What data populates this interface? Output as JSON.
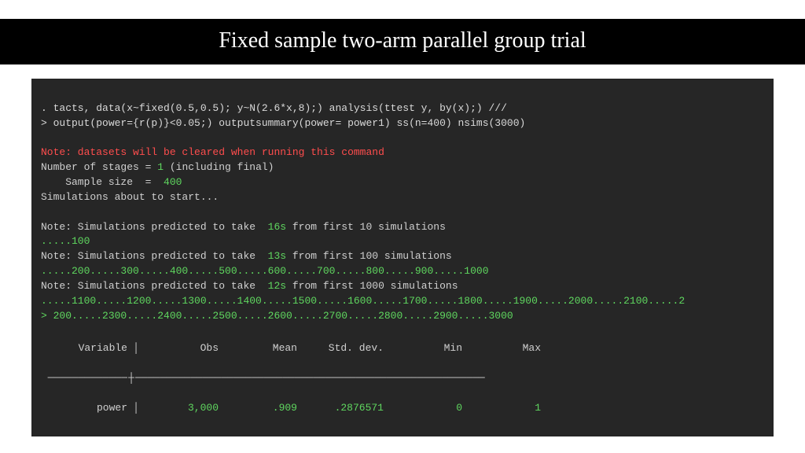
{
  "title": "Fixed sample two-arm parallel group trial",
  "cmd1": ". tacts, data(x~fixed(0.5,0.5); y~N(2.6*x,8);) analysis(ttest y, by(x);) ///",
  "cmd2": "> output(power={r(p)}<0.05;) outputsummary(power= power1) ss(n=400) nsims(3000)",
  "warn": "Note: datasets will be cleared when running this command",
  "line_stages_a": "Number of stages = ",
  "line_stages_n": "1",
  "line_stages_b": " (including final)",
  "line_ss_a": "    Sample size  =  ",
  "line_ss_n": "400",
  "line_start": "Simulations about to start...",
  "pred1_a": "Note: Simulations predicted to take  ",
  "pred1_n": "16s",
  "pred1_b": " from first 10 simulations",
  "dots1": ".....100",
  "pred2_a": "Note: Simulations predicted to take  ",
  "pred2_n": "13s",
  "pred2_b": " from first 100 simulations",
  "dots2": ".....200.....300.....400.....500.....600.....700.....800.....900.....1000",
  "pred3_a": "Note: Simulations predicted to take  ",
  "pred3_n": "12s",
  "pred3_b": " from first 1000 simulations",
  "dots3": ".....1100.....1200.....1300.....1400.....1500.....1600.....1700.....1800.....1900.....2000.....2100.....2",
  "dots4": "> 200.....2300.....2400.....2500.....2600.....2700.....2800.....2900.....3000",
  "tbl_hdr_var": "Variable",
  "tbl_hdr_obs": "Obs",
  "tbl_hdr_mean": "Mean",
  "tbl_hdr_sd": "Std. dev.",
  "tbl_hdr_min": "Min",
  "tbl_hdr_max": "Max",
  "tbl_row_var": "power",
  "tbl_row_obs": "3,000",
  "tbl_row_mean": ".909",
  "tbl_row_sd": ".2876571",
  "tbl_row_min": "0",
  "tbl_row_max": "1",
  "hr_left": "─────────────",
  "hr_plus": "┼",
  "hr_right": "─────────────────────────────────────────────────────────",
  "pipe": "│"
}
